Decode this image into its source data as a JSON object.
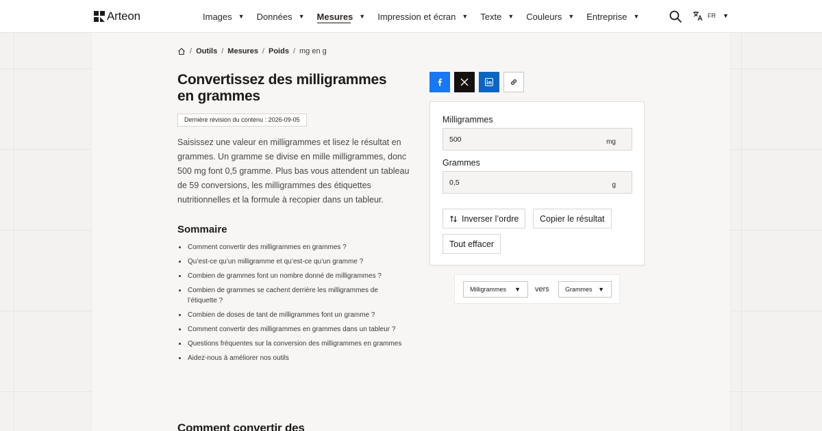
{
  "brand": {
    "name": "Arteon"
  },
  "nav": {
    "items": [
      {
        "label": "Images",
        "active": false
      },
      {
        "label": "Données",
        "active": false
      },
      {
        "label": "Mesures",
        "active": true
      },
      {
        "label": "Impression et écran",
        "active": false
      },
      {
        "label": "Texte",
        "active": false
      },
      {
        "label": "Couleurs",
        "active": false
      },
      {
        "label": "Entreprise",
        "active": false
      }
    ],
    "caret": "▼",
    "lang_code": "FR"
  },
  "breadcrumb": {
    "items": [
      "Outils",
      "Mesures",
      "Poids"
    ],
    "current": "mg en g",
    "separator": "/"
  },
  "page": {
    "title": "Convertissez des milligrammes en grammes",
    "revision": "Dernière révision du contenu : 2026-09-05",
    "intro": "Saisissez une valeur en milligrammes et lisez le résultat en grammes. Un gramme se divise en mille milligrammes, donc 500 mg font 0,5 gramme. Plus bas vous attendent un tableau de 59 conversions, les milligrammes des étiquettes nutritionnelles et la formule à recopier dans un tableur.",
    "toc_title": "Sommaire",
    "toc": [
      "Comment convertir des milligrammes en grammes ?",
      "Qu’est-ce qu’un milligramme et qu’est-ce qu’un gramme ?",
      "Combien de grammes font un nombre donné de milligrammes ?",
      "Combien de grammes se cachent derrière les milligrammes de l’étiquette ?",
      "Combien de doses de tant de milligrammes font un gramme ?",
      "Comment convertir des milligrammes en grammes dans un tableur ?",
      "Questions fréquentes sur la conversion des milligrammes en grammes",
      "Aidez-nous à améliorer nos outils"
    ],
    "next_heading": "Comment convertir des"
  },
  "share": {
    "icons": [
      "facebook-icon",
      "x-icon",
      "linkedin-icon",
      "link-icon"
    ],
    "colors": {
      "facebook": "#1877f2",
      "x": "#14110f",
      "linkedin": "#0a66c2"
    }
  },
  "converter": {
    "from_label": "Milligrammes",
    "from_value": "500",
    "from_unit": "mg",
    "to_label": "Grammes",
    "to_value": "0,5",
    "to_unit": "g",
    "swap_label": "Inverser l’ordre",
    "copy_label": "Copier le résultat",
    "clear_label": "Tout effacer"
  },
  "unit_selector": {
    "from": "Milligrammes",
    "connector": "vers",
    "to": "Grammes"
  }
}
